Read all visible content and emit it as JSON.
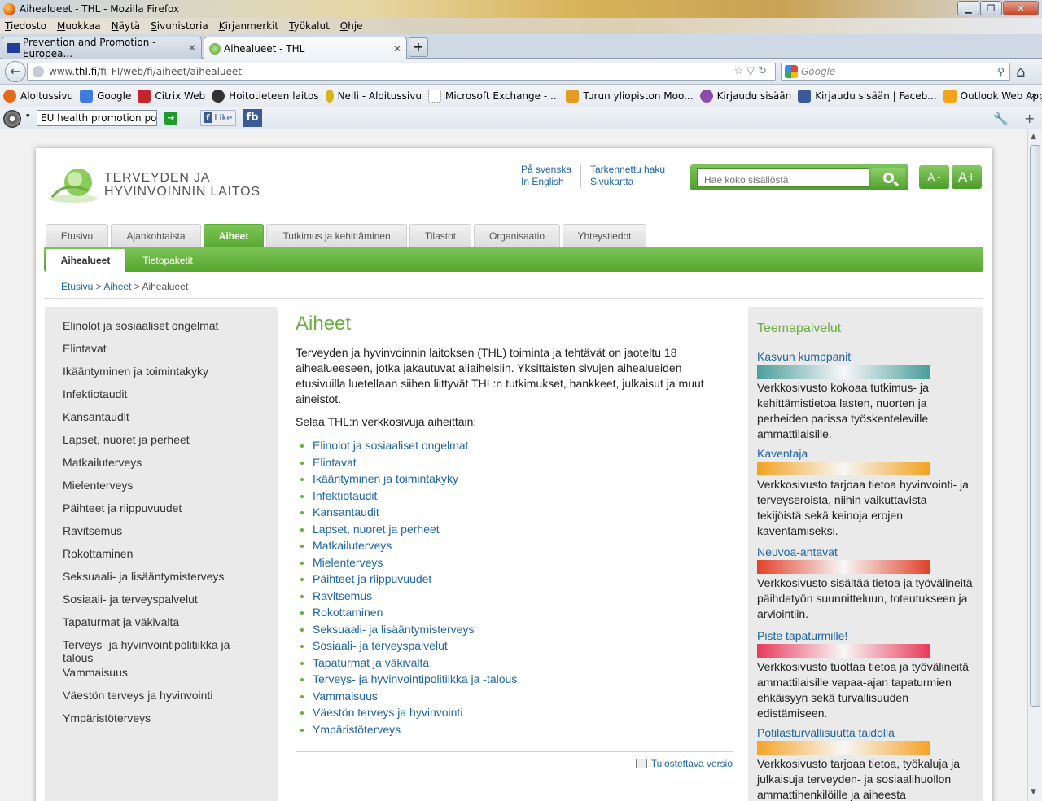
{
  "browser": {
    "window_title": "Aihealueet - THL - Mozilla Firefox",
    "menu": [
      "Tiedosto",
      "Muokkaa",
      "Näytä",
      "Sivuhistoria",
      "Kirjanmerkit",
      "Työkalut",
      "Ohje"
    ],
    "tabs": [
      {
        "label": "Prevention and Promotion - Europea..."
      },
      {
        "label": "Aihealueet - THL"
      }
    ],
    "url_prefix": "www.",
    "url_host": "thl.fi",
    "url_path": "/fi_FI/web/fi/aiheet/aihealueet",
    "search_placeholder": "Google",
    "bookmarks": [
      {
        "label": "Aloitussivu",
        "color": "#e56a1a"
      },
      {
        "label": "Google",
        "color": "#3f7be0"
      },
      {
        "label": "Citrix Web",
        "color": "#c2262b"
      },
      {
        "label": "Hoitotieteen laitos",
        "color": "#333333"
      },
      {
        "label": "Nelli - Aloitussivu",
        "color": "#d8b41c"
      },
      {
        "label": "Microsoft Exchange - ...",
        "color": "#ffffff"
      },
      {
        "label": "Turun yliopiston Moo...",
        "color": "#e39b22"
      },
      {
        "label": "Kirjaudu sisään",
        "color": "#8a4ca8"
      },
      {
        "label": "Kirjaudu sisään | Faceb...",
        "color": "#3b5998"
      },
      {
        "label": "Outlook Web App",
        "color": "#f0a41c"
      }
    ],
    "addon_input_value": "EU health promotion policy",
    "like_label": "Like",
    "fb_label": "fb"
  },
  "site": {
    "logo_line1": "TERVEYDEN JA",
    "logo_line2": "HYVINVOINNIN LAITOS",
    "lang_links": [
      "På svenska",
      "In English"
    ],
    "util_links": [
      "Tarkennettu haku",
      "Sivukartta"
    ],
    "search_placeholder": "Hae koko sisällöstä",
    "font_small": "A -",
    "font_big": "A+",
    "main_tabs": [
      "Etusivu",
      "Ajankohtaista",
      "Aiheet",
      "Tutkimus ja kehittäminen",
      "Tilastot",
      "Organisaatio",
      "Yhteystiedot"
    ],
    "sub_tabs": [
      "Aihealueet",
      "Tietopaketit"
    ],
    "breadcrumb": {
      "home": "Etusivu",
      "section": "Aiheet",
      "current": "Aihealueet",
      "sep": ">"
    },
    "topics": [
      "Elinolot ja sosiaaliset ongelmat",
      "Elintavat",
      "Ikääntyminen ja toimintakyky",
      "Infektiotaudit",
      "Kansantaudit",
      "Lapset, nuoret ja perheet",
      "Matkailuterveys",
      "Mielenterveys",
      "Päihteet ja riippuvuudet",
      "Ravitsemus",
      "Rokottaminen",
      "Seksuaali- ja lisääntymisterveys",
      "Sosiaali- ja terveyspalvelut",
      "Tapaturmat ja väkivalta",
      "Terveys- ja hyvinvointipolitiikka ja -talous",
      "Vammaisuus",
      "Väestön terveys ja hyvinvointi",
      "Ympäristöterveys"
    ],
    "main": {
      "heading": "Aiheet",
      "intro": "Terveyden ja hyvinvoinnin laitoksen (THL) toiminta ja tehtävät on jaoteltu 18 aihealueeseen, jotka jakautuvat aliaiheisiin. Yksittäisten sivujen aihealueiden etusivuilla luetellaan siihen liittyvät THL:n tutkimukset, hankkeet, julkaisut ja muut aineistot.",
      "browse": "Selaa THL:n verkkosivuja aiheittain:",
      "print_label": "Tulostettava versio"
    },
    "sidebar": {
      "heading": "Teemapalvelut",
      "services": [
        {
          "name": "Kasvun kumppanit",
          "desc": "Verkkosivusto kokoaa tutkimus- ja kehittämistietoa lasten, nuorten ja perheiden parissa työskenteleville ammattilaisille.",
          "banner_color": "#4b9e9c"
        },
        {
          "name": "Kaventaja",
          "desc": "Verkkosivusto tarjoaa tietoa hyvinvointi- ja terveyseroista, niihin vaikuttavista tekijöistä sekä keinoja erojen kaventamiseksi.",
          "banner_color": "#f2a21f"
        },
        {
          "name": "Neuvoa-antavat",
          "desc": "Verkkosivusto sisältää tietoa ja työvälineitä päihdetyön suunnitteluun, toteutukseen ja arviointiin.",
          "banner_color": "#e0422a"
        },
        {
          "name": "Piste tapaturmille!",
          "desc": "Verkkosivusto tuottaa tietoa ja työvälineitä ammattilaisille vapaa-ajan tapaturmien ehkäisyyn sekä turvallisuuden edistämiseen.",
          "banner_color": "#e83b5a"
        },
        {
          "name": "Potilasturvallisuutta taidolla",
          "desc": "Verkkosivusto tarjoaa tietoa, työkaluja ja julkaisuja terveyden- ja sosiaalihuollon ammattihenkilöille ja aiheesta",
          "banner_color": "#f4a428"
        }
      ]
    }
  }
}
